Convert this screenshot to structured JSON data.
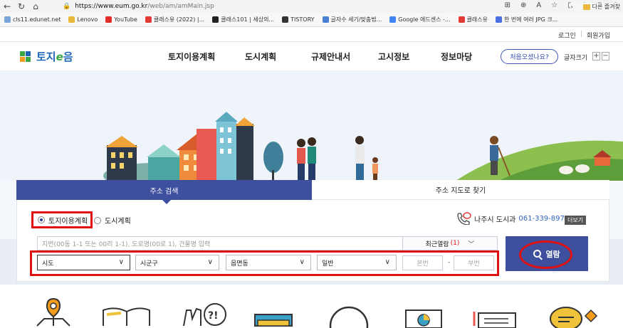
{
  "browser": {
    "url_host": "https://www.eum.go.kr",
    "url_path": "/web/am/amMain.jsp",
    "bookmarks": [
      {
        "label": "cls11.edunet.net",
        "color": "#7aa7d9"
      },
      {
        "label": "Lenovo",
        "color": "#e8b93a"
      },
      {
        "label": "YouTube",
        "color": "#e52d27"
      },
      {
        "label": "클래스유 (2022) |...",
        "color": "#e53935"
      },
      {
        "label": "클래스101 | 세상의...",
        "color": "#222222"
      },
      {
        "label": "TISTORY",
        "color": "#333333"
      },
      {
        "label": "글자수 세기/맞춤법...",
        "color": "#4a7fd4"
      },
      {
        "label": "Google 애드센스 -...",
        "color": "#4285f4"
      },
      {
        "label": "클래스유",
        "color": "#e53935"
      },
      {
        "label": "한 번에 여러 JPG 크...",
        "color": "#4a6fe3"
      }
    ],
    "bookmarks_more": "다른 즐겨찾"
  },
  "util": {
    "login": "로그인",
    "join": "회원가입"
  },
  "header": {
    "logo_pre": "토지",
    "logo_e": "e",
    "logo_post": "음",
    "nav": [
      "토지이용계획",
      "도시계획",
      "규제안내서",
      "고시정보",
      "정보마당"
    ],
    "first_visit": "처음오셨나요?",
    "font_size": "글자크기",
    "plus": "+",
    "minus": "−"
  },
  "search": {
    "tab_active": "주소 검색",
    "tab_other": "주소 지도로 찾기",
    "radio_1": "토지이용계획",
    "radio_2": "도시계획",
    "contact_label": "나주시 도시과",
    "contact_phone": "061-339-8973",
    "more": "더보기",
    "address_placeholder": "지번(00동 1-1 또는 00리 1-1), 도로명(00로 1), 건물명 입력",
    "recent_label": "최근열람",
    "recent_count": "(1)",
    "selects": [
      "시도",
      "시군구",
      "읍면동",
      "일반"
    ],
    "main_no": "본번",
    "sub_no": "부번",
    "dash": "-",
    "go": "열람"
  },
  "colors": {
    "accent": "#3e4f9d",
    "highlight": "#e01010",
    "brand": "#1c64b8"
  }
}
